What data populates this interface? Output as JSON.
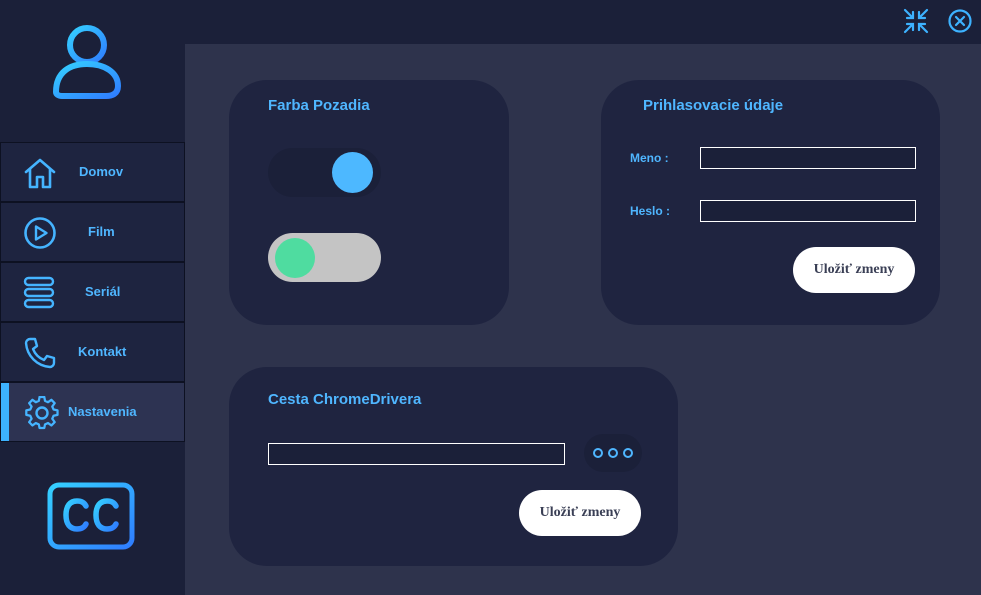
{
  "colors": {
    "accent": "#4fb6ff",
    "toggle_on_knob": "#4db8ff",
    "toggle_off_knob": "#4fdca0",
    "toggle_off_track": "#c4c4c4",
    "card_bg": "#1f2440",
    "main_bg": "#2e334c"
  },
  "window_controls": {
    "minimize_icon": "compress-arrows-icon",
    "close_icon": "close-circle-icon"
  },
  "sidebar": {
    "avatar_icon": "user-icon",
    "items": [
      {
        "label": "Domov",
        "icon": "home-icon",
        "active": false
      },
      {
        "label": "Film",
        "icon": "play-circle-icon",
        "active": false
      },
      {
        "label": "Seriál",
        "icon": "layers-icon",
        "active": false
      },
      {
        "label": "Kontakt",
        "icon": "phone-icon",
        "active": false
      },
      {
        "label": "Nastavenia",
        "icon": "gear-icon",
        "active": true
      }
    ],
    "logo_icon": "closed-captions-icon"
  },
  "background_card": {
    "title": "Farba Pozadia",
    "toggles": [
      {
        "state": "on"
      },
      {
        "state": "off"
      }
    ]
  },
  "login_card": {
    "title": "Prihlasovacie údaje",
    "username_label": "Meno :",
    "username_value": "",
    "password_label": "Heslo :",
    "password_value": "",
    "save_label": "Uložiť zmeny"
  },
  "chromedriver_card": {
    "title": "Cesta ChromeDrivera",
    "path_value": "",
    "browse_icon": "more-dots-icon",
    "save_label": "Uložiť zmeny"
  }
}
